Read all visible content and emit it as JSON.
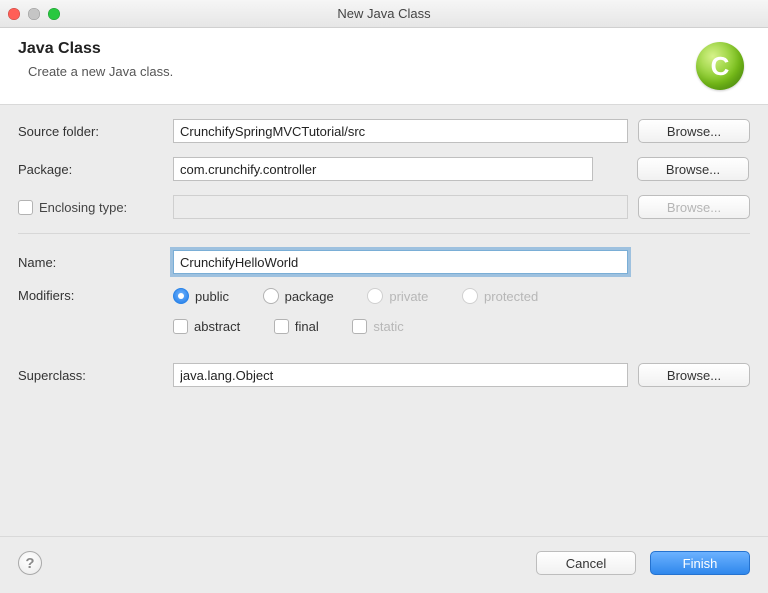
{
  "window": {
    "title": "New Java Class"
  },
  "header": {
    "heading": "Java Class",
    "subtitle": "Create a new Java class.",
    "logo_letter": "C"
  },
  "labels": {
    "source_folder": "Source folder:",
    "package": "Package:",
    "enclosing_type": "Enclosing type:",
    "name": "Name:",
    "modifiers": "Modifiers:",
    "superclass": "Superclass:"
  },
  "values": {
    "source_folder": "CrunchifySpringMVCTutorial/src",
    "package": "com.crunchify.controller",
    "enclosing_type": "",
    "name": "CrunchifyHelloWorld",
    "superclass": "java.lang.Object"
  },
  "modifiers": {
    "access": {
      "public": "public",
      "package": "package",
      "private": "private",
      "protected": "protected",
      "selected": "public"
    },
    "other": {
      "abstract": "abstract",
      "final": "final",
      "static": "static"
    }
  },
  "buttons": {
    "browse": "Browse...",
    "cancel": "Cancel",
    "finish": "Finish"
  }
}
